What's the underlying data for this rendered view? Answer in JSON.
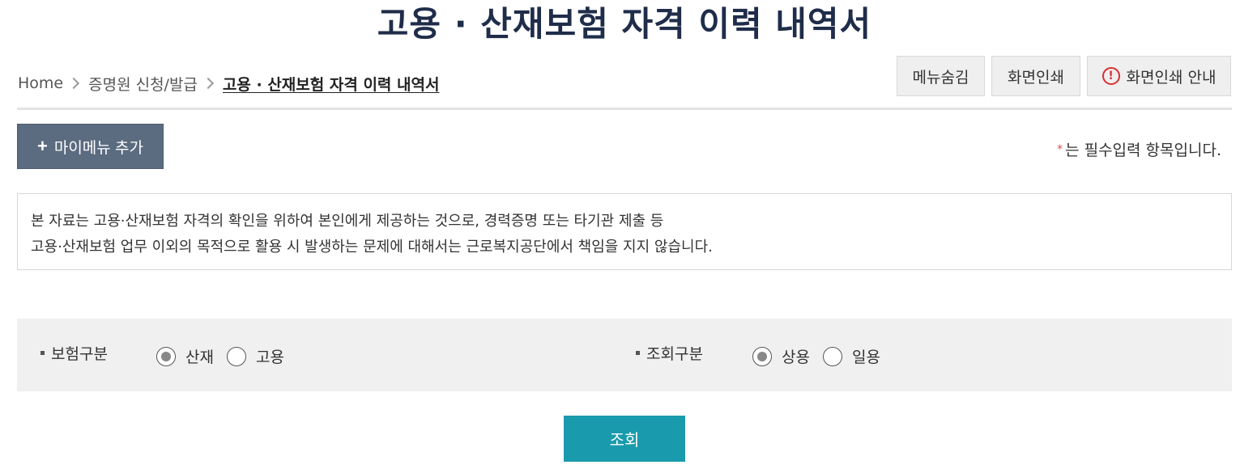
{
  "title": "고용 · 산재보험 자격 이력 내역서",
  "breadcrumb": {
    "home": "Home",
    "level1": "증명원 신청/발급",
    "current": "고용 · 산재보험 자격 이력 내역서"
  },
  "toolbar": {
    "hide_menu": "메뉴숨김",
    "print": "화면인쇄",
    "print_guide": "화면인쇄 안내",
    "print_guide_icon": "alert-circle-icon"
  },
  "mymenu": {
    "plus": "+",
    "label": "마이메뉴 추가"
  },
  "required_note": {
    "star": "*",
    "text": "는 필수입력 항목입니다."
  },
  "notice": {
    "line1": "본 자료는 고용·산재보험 자격의 확인을 위하여 본인에게 제공하는 것으로, 경력증명 또는 타기관 제출 등",
    "line2": "고용·산재보험 업무 이외의 목적으로 활용 시 발생하는 문제에 대해서는 근로복지공단에서 책임을 지지 않습니다."
  },
  "form": {
    "insurance_type": {
      "label": "보험구분",
      "options": [
        {
          "label": "산재",
          "checked": true
        },
        {
          "label": "고용",
          "checked": false
        }
      ]
    },
    "query_type": {
      "label": "조회구분",
      "options": [
        {
          "label": "상용",
          "checked": true
        },
        {
          "label": "일용",
          "checked": false
        }
      ]
    }
  },
  "search_button": "조회",
  "colors": {
    "title": "#1f2d4a",
    "mymenu_button": "#5b6b80",
    "search_button": "#1a9aad",
    "required_star": "#e04848",
    "alert_icon": "#d93030"
  }
}
